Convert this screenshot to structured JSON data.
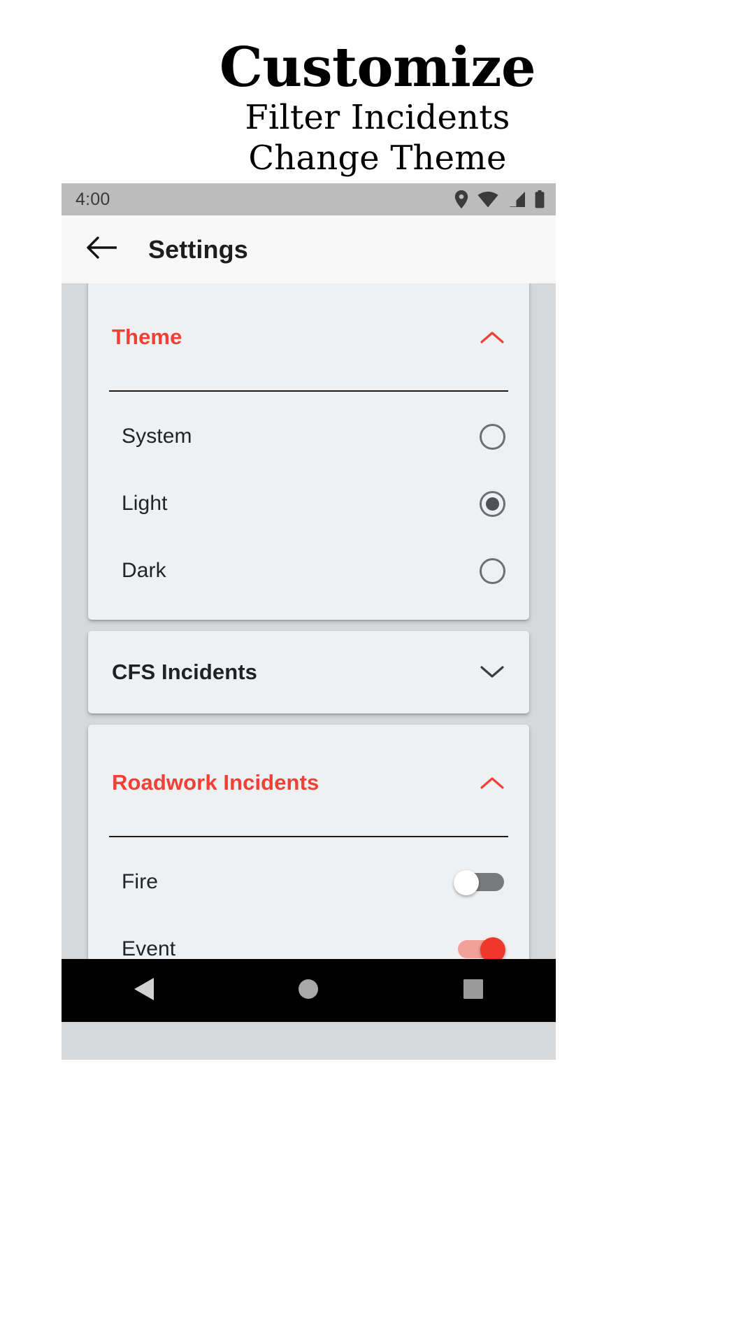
{
  "promo": {
    "title": "Customize",
    "sub1": "Filter Incidents",
    "sub2": "Change Theme"
  },
  "colors": {
    "accent": "#ef4136",
    "switch_on_track": "#f2a09a",
    "switch_on_thumb": "#f0372b",
    "switch_off_track": "#78797c",
    "card_bg": "#eef0f2",
    "page_bg": "#d6d8da",
    "statusbar_bg": "#bcbcbc",
    "appbar_bg": "#f8f8f8",
    "navbar_bg": "#000000"
  },
  "statusbar": {
    "time": "4:00",
    "icons": [
      "location-pin-icon",
      "wifi-icon",
      "cellular-signal-icon",
      "battery-icon"
    ]
  },
  "appbar": {
    "back_icon": "arrow-back-icon",
    "title": "Settings"
  },
  "cards": [
    {
      "id": "theme",
      "title": "Theme",
      "expanded": true,
      "chevron": "chevron-up-icon",
      "control_type": "radio",
      "rows": [
        {
          "label": "System",
          "selected": false
        },
        {
          "label": "Light",
          "selected": true
        },
        {
          "label": "Dark",
          "selected": false
        }
      ]
    },
    {
      "id": "cfs-incidents",
      "title": "CFS Incidents",
      "expanded": false,
      "chevron": "chevron-down-icon",
      "control_type": "none",
      "rows": []
    },
    {
      "id": "roadwork-incidents",
      "title": "Roadwork Incidents",
      "expanded": true,
      "chevron": "chevron-up-icon",
      "control_type": "switch",
      "rows": [
        {
          "label": "Fire",
          "on": false
        },
        {
          "label": "Event",
          "on": true
        }
      ]
    }
  ],
  "navbar": {
    "items": [
      {
        "name": "nav-back-icon",
        "glyph": "triangle-left"
      },
      {
        "name": "nav-home-icon",
        "glyph": "circle"
      },
      {
        "name": "nav-recents-icon",
        "glyph": "square"
      }
    ]
  }
}
